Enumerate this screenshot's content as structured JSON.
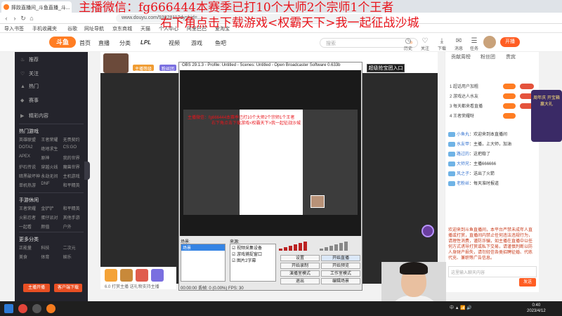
{
  "browser": {
    "tab_title": "摔跤直播间_斗鱼直播_斗...",
    "url": "www.douyu.com/9382811?dyshid=...",
    "bookmarks": [
      "导入书签",
      "手机收藏夹",
      "谷歌",
      "网址导航",
      "京东商城",
      "天猫",
      "个人中心",
      "阿里巴巴",
      "爱淘宝"
    ]
  },
  "overlay": {
    "line1": "主播微信：fg666444本赛季已打10个大师2个宗师1个王者",
    "line2": "右下角点击下载游戏<权霸天下>我一起征战沙城"
  },
  "site": {
    "nav": [
      "首页",
      "直播",
      "分类",
      "LPL",
      "视频",
      "游戏",
      "鱼吧"
    ],
    "search_placeholder": "搜索",
    "header_icons": [
      "历史",
      "关注",
      "下载",
      "消息",
      "任务"
    ],
    "open_label": "开播"
  },
  "sidebar": {
    "top_items": [
      "推荐",
      "关注",
      "热门",
      "赛事",
      "精彩内容"
    ],
    "section_hot": "热门游戏",
    "hot_grid": [
      "英雄联盟",
      "王者荣耀",
      "无畏契约",
      "DOTA2",
      "绝地求生",
      "CS:GO",
      "APEX",
      "原神",
      "我的世界",
      "炉石传说",
      "穿越火线",
      "魔兽世界",
      "暗黑破坏神",
      "永劫无间",
      "主机游戏",
      "单机热游",
      "DNF",
      "和平精英"
    ],
    "section_mobile": "手游休闲",
    "mobile_grid": [
      "王者荣耀",
      "金铲铲",
      "和平精英",
      "火影忍者",
      "蛋仔派对",
      "其他手游",
      "一起看",
      "颜值",
      "户外"
    ],
    "section_more": "更多分类",
    "more_grid": [
      "正能量",
      "科技",
      "二次元",
      "美食",
      "体育",
      "娱乐"
    ],
    "btn_start": "主播开播",
    "btn_download": "客户端下载"
  },
  "room": {
    "tags": [
      "主播等级",
      "粉丝团",
      "关注"
    ],
    "join_btn": "超级抢宝团入口"
  },
  "obs": {
    "title": "OBS 29.1.3 - Profile: Untitled - Scenes: Untitled - Open Broadcaster Software 0.633b",
    "nested_line1": "主播微信：fg666444本赛季已打10个大师2个宗师1个王者",
    "nested_line2": "右下角点击下载游戏<权霸天下>我一起征战沙城",
    "scenes_label": "场景:",
    "scene_selected": "场景",
    "sources_label": "来源:",
    "sources": [
      "视频采集设备",
      "游戏捕捉窗口",
      "图片2字幕"
    ],
    "buttons": [
      "设置",
      "开始直播",
      "开始录制",
      "开始预览",
      "演播室模式",
      "工作室模式",
      "退出",
      "编辑场景"
    ],
    "status": "00:00:00    丢帧: 0 (0.00%)    FPS: 30"
  },
  "gift_text": "6.0 打赏主播 送礼物支持主播",
  "chat": {
    "tabs": [
      "贡献周榜",
      "粉丝团",
      "贵宾"
    ],
    "rank": [
      {
        "name": "超话用户加粗",
        "pos": "1"
      },
      {
        "name": "游戏达人水友",
        "pos": "2"
      },
      {
        "name": "每天都来看直播",
        "pos": "3"
      },
      {
        "name": "王者荣耀呀",
        "pos": "4"
      }
    ],
    "messages": [
      {
        "name": "小鱼丸",
        "text": "欢迎来到本直播间"
      },
      {
        "name": "水友甲",
        "text": "主播，上大师，加油"
      },
      {
        "name": "路过的",
        "text": "这把稳了"
      },
      {
        "name": "大师兄",
        "text": "主播666666"
      },
      {
        "name": "风之子",
        "text": "送出了火箭"
      },
      {
        "name": "老粉丝",
        "text": "每天准时报道"
      }
    ],
    "notice": "欢迎来到斗鱼直播间，本平台严禁未成年人直播或打赏，直播间内禁止任何违法违规行为，请理性消费，谨防诈骗，如主播在直播中以任何方式诱导打赏或私下交易，请谨慎判断以防人身财产损失，请勿轻信各类招聘征婚、代练代充、兼职等广告信息。",
    "input_placeholder": "这里输入聊天内容",
    "send_label": "发送",
    "promo": "周年庆 开宝箱 赢大礼"
  },
  "taskbar": {
    "tray": "中 ▲ 📶 🔊",
    "time": "0:40",
    "date": "2023/4/12"
  }
}
